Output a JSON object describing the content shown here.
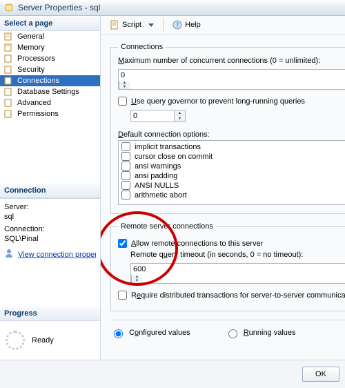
{
  "title": "Server Properties - sql",
  "sidebar": {
    "header": "Select a page",
    "items": [
      {
        "label": "General"
      },
      {
        "label": "Memory"
      },
      {
        "label": "Processors"
      },
      {
        "label": "Security"
      },
      {
        "label": "Connections",
        "selected": true
      },
      {
        "label": "Database Settings"
      },
      {
        "label": "Advanced"
      },
      {
        "label": "Permissions"
      }
    ],
    "connection_header": "Connection",
    "server_label": "Server:",
    "server_value": "sql",
    "connection_label": "Connection:",
    "connection_value": "SQL\\Pinal",
    "view_props": "View connection properties",
    "progress_header": "Progress",
    "progress_status": "Ready"
  },
  "toolbar": {
    "script": "Script",
    "help": "Help"
  },
  "page": {
    "conn_legend": "Connections",
    "max_conn_label": "Maximum number of concurrent connections (0 = unlimited):",
    "max_conn_value": "0",
    "use_query_gov": "Use query governor to prevent long-running queries",
    "query_gov_value": "0",
    "default_opts_label": "Default connection options:",
    "options": [
      "implicit transactions",
      "cursor close on commit",
      "ansi warnings",
      "ansi padding",
      "ANSI NULLS",
      "arithmetic abort"
    ],
    "remote_legend": "Remote server connections",
    "allow_remote": "Allow remote connections to this server",
    "remote_timeout_label": "Remote query timeout (in seconds, 0 = no timeout):",
    "remote_timeout_value": "600",
    "require_dist": "Require distributed transactions for server-to-server communication",
    "configured": "Configured values",
    "running": "Running values"
  },
  "buttons": {
    "ok": "OK"
  }
}
